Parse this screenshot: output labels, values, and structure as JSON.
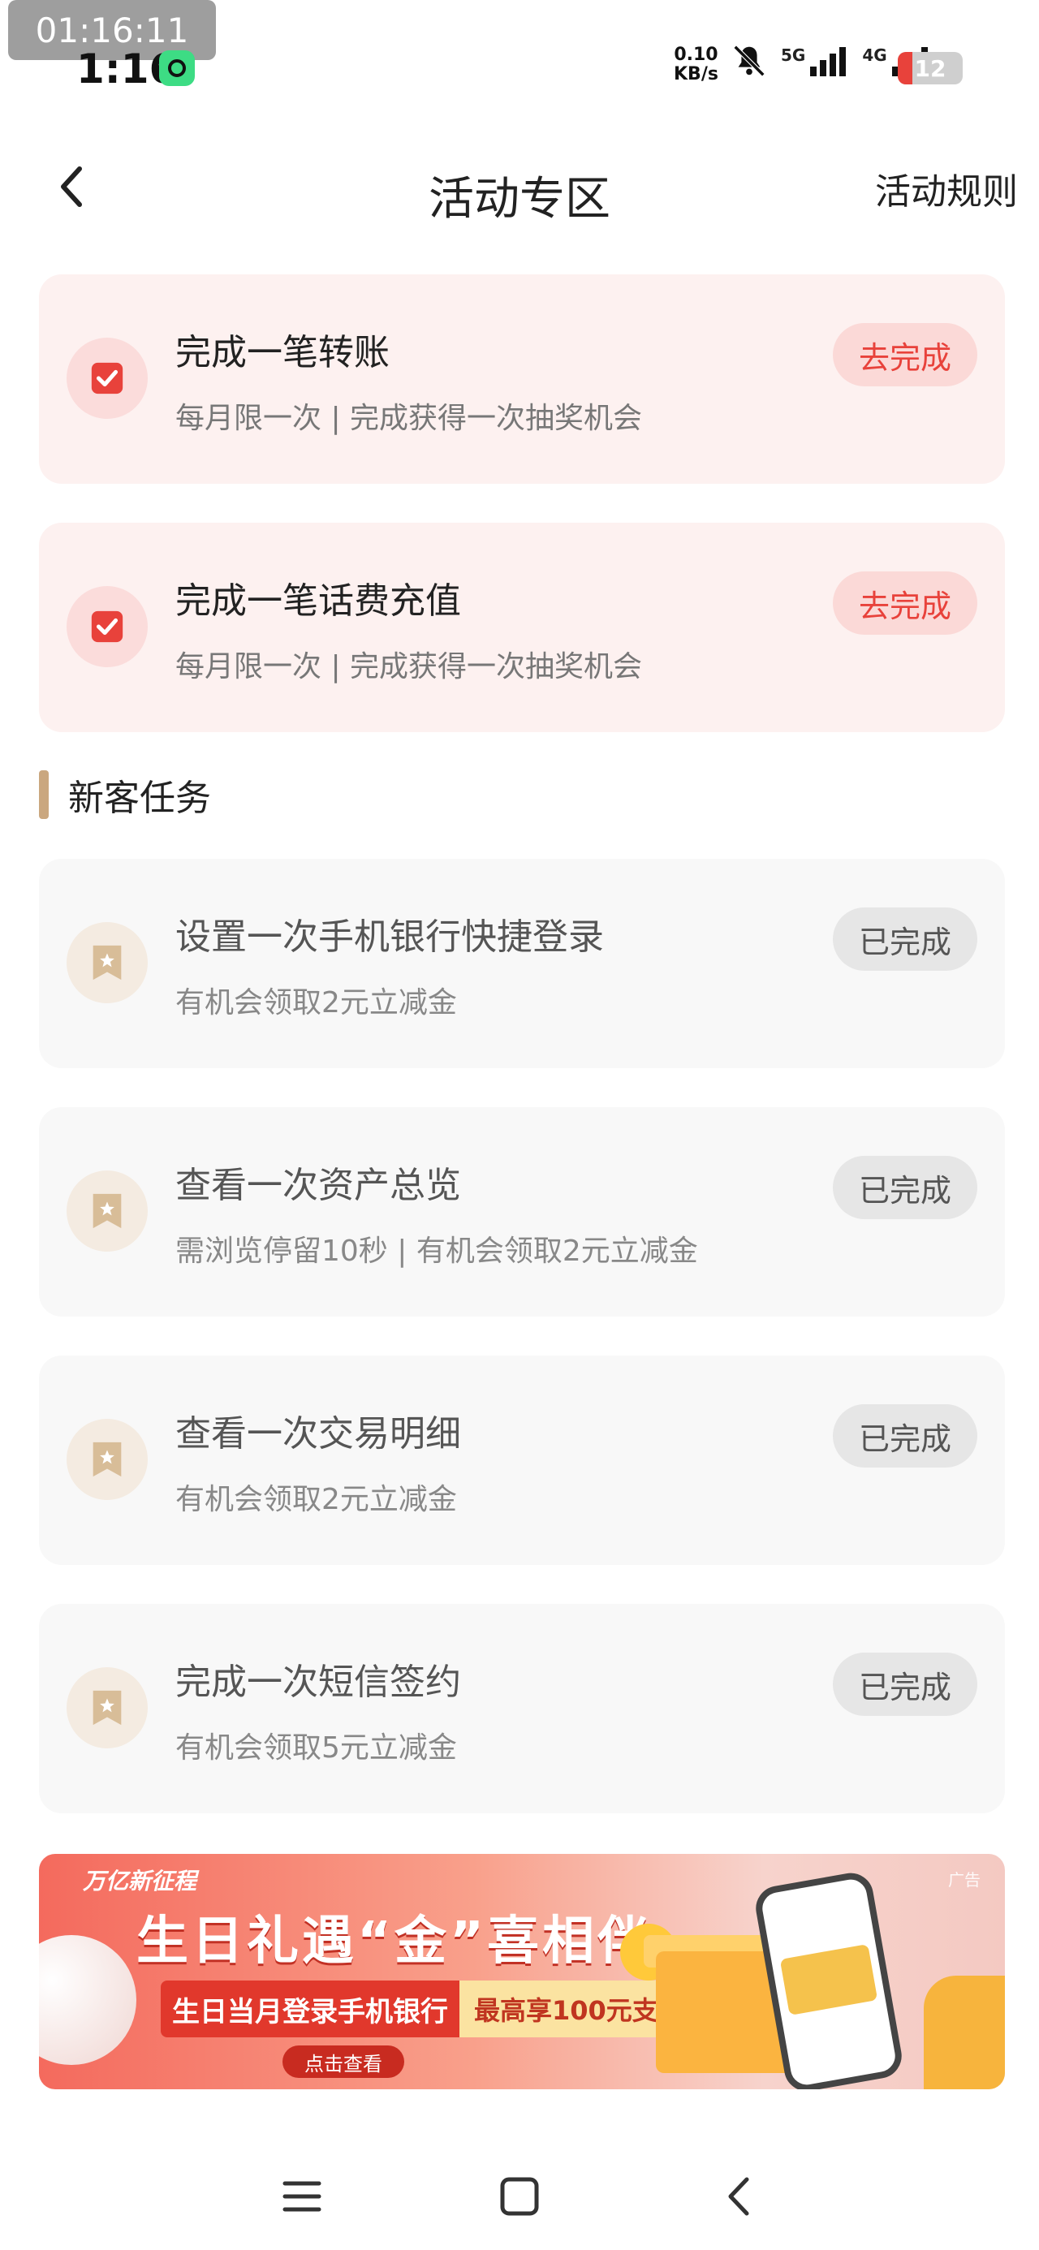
{
  "status_bar": {
    "recording_time": "01:16:11",
    "clock": "1:16",
    "net_speed_value": "0.10",
    "net_speed_unit": "KB/s",
    "signal_1_label": "5G",
    "signal_2_label": "4G",
    "battery_level": "12",
    "battery_color": "#e8423b"
  },
  "header": {
    "title": "活动专区",
    "rules_link": "活动规则"
  },
  "activity_tasks": [
    {
      "title": "完成一笔转账",
      "desc": "每月限一次 | 完成获得一次抽奖机会",
      "button": "去完成",
      "icon": "checkbox-icon"
    },
    {
      "title": "完成一笔话费充值",
      "desc": "每月限一次 | 完成获得一次抽奖机会",
      "button": "去完成",
      "icon": "checkbox-icon"
    }
  ],
  "new_customer_section": {
    "title": "新客任务"
  },
  "new_customer_tasks": [
    {
      "title": "设置一次手机银行快捷登录",
      "desc": "有机会领取2元立减金",
      "button": "已完成",
      "icon": "bookmark-star-icon"
    },
    {
      "title": "查看一次资产总览",
      "desc": "需浏览停留10秒 | 有机会领取2元立减金",
      "button": "已完成",
      "icon": "bookmark-star-icon"
    },
    {
      "title": "查看一次交易明细",
      "desc": "有机会领取2元立减金",
      "button": "已完成",
      "icon": "bookmark-star-icon"
    },
    {
      "title": "完成一次短信签约",
      "desc": "有机会领取5元立减金",
      "button": "已完成",
      "icon": "bookmark-star-icon"
    }
  ],
  "banner": {
    "logo": "万亿新征程",
    "ad_tag": "广告",
    "headline": "生日礼遇“金”喜相伴",
    "strip_left": "生日当月登录手机银行",
    "strip_right": "最高享100元支付宝立减金",
    "cta": "点击查看"
  },
  "colors": {
    "accent_red": "#e8423b",
    "pink_card_bg": "#fdf1f0",
    "grey_card_bg": "#f8f8f8",
    "section_bar": "#caa77f"
  }
}
